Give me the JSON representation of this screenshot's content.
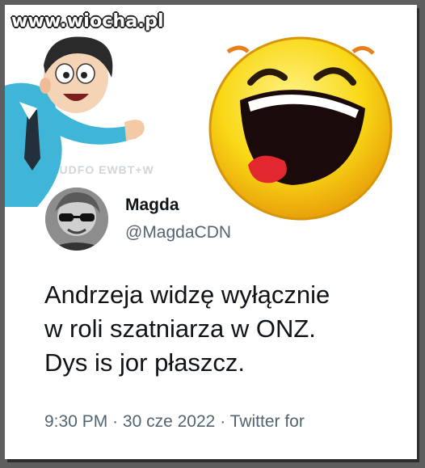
{
  "watermark": "www.wiocha.pl",
  "ghost_text": "LUDFO EWBT+W",
  "tweet": {
    "author_name": "Magda",
    "author_handle": "@MagdaCDN",
    "text_lines": [
      "Andrzeja widzę wyłącznie",
      "w roli szatniarza w ONZ.",
      "Dys is jor płaszcz."
    ],
    "time": "9:30 PM",
    "separator": "·",
    "date": "30 cze 2022",
    "source": "Twitter for"
  },
  "colors": {
    "text_primary": "#0f1419",
    "text_secondary": "#536471",
    "emoji_yellow": "#f9d816"
  },
  "icons": [
    "cartoon-businessman",
    "laughing-emoji",
    "avatar-photo"
  ]
}
